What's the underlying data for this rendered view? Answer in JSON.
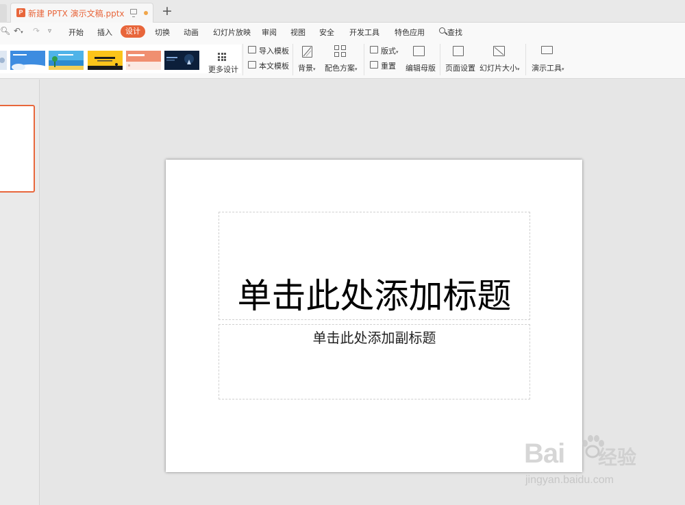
{
  "tab": {
    "title": "新建 PPTX 演示文稿.pptx",
    "p_glyph": "P"
  },
  "menu": {
    "items": [
      "开始",
      "插入",
      "设计",
      "切换",
      "动画",
      "幻灯片放映",
      "审阅",
      "视图",
      "安全",
      "开发工具",
      "特色应用"
    ],
    "active": "设计",
    "search": "查找"
  },
  "ribbon": {
    "more_design": "更多设计",
    "import_template": "导入模板",
    "this_template": "本文模板",
    "background": "背景",
    "color_scheme": "配色方案",
    "layout": "版式",
    "reset": "重置",
    "edit_master": "编辑母版",
    "page_setup": "页面设置",
    "slide_size": "幻灯片大小",
    "presentation_tools": "演示工具"
  },
  "slide": {
    "title_placeholder": "单击此处添加标题",
    "subtitle_placeholder": "单击此处添加副标题"
  },
  "watermark": {
    "brand": "Bai",
    "brand2": "经验",
    "url": "jingyan.baidu.com"
  },
  "colors": {
    "accent": "#e8663b"
  }
}
